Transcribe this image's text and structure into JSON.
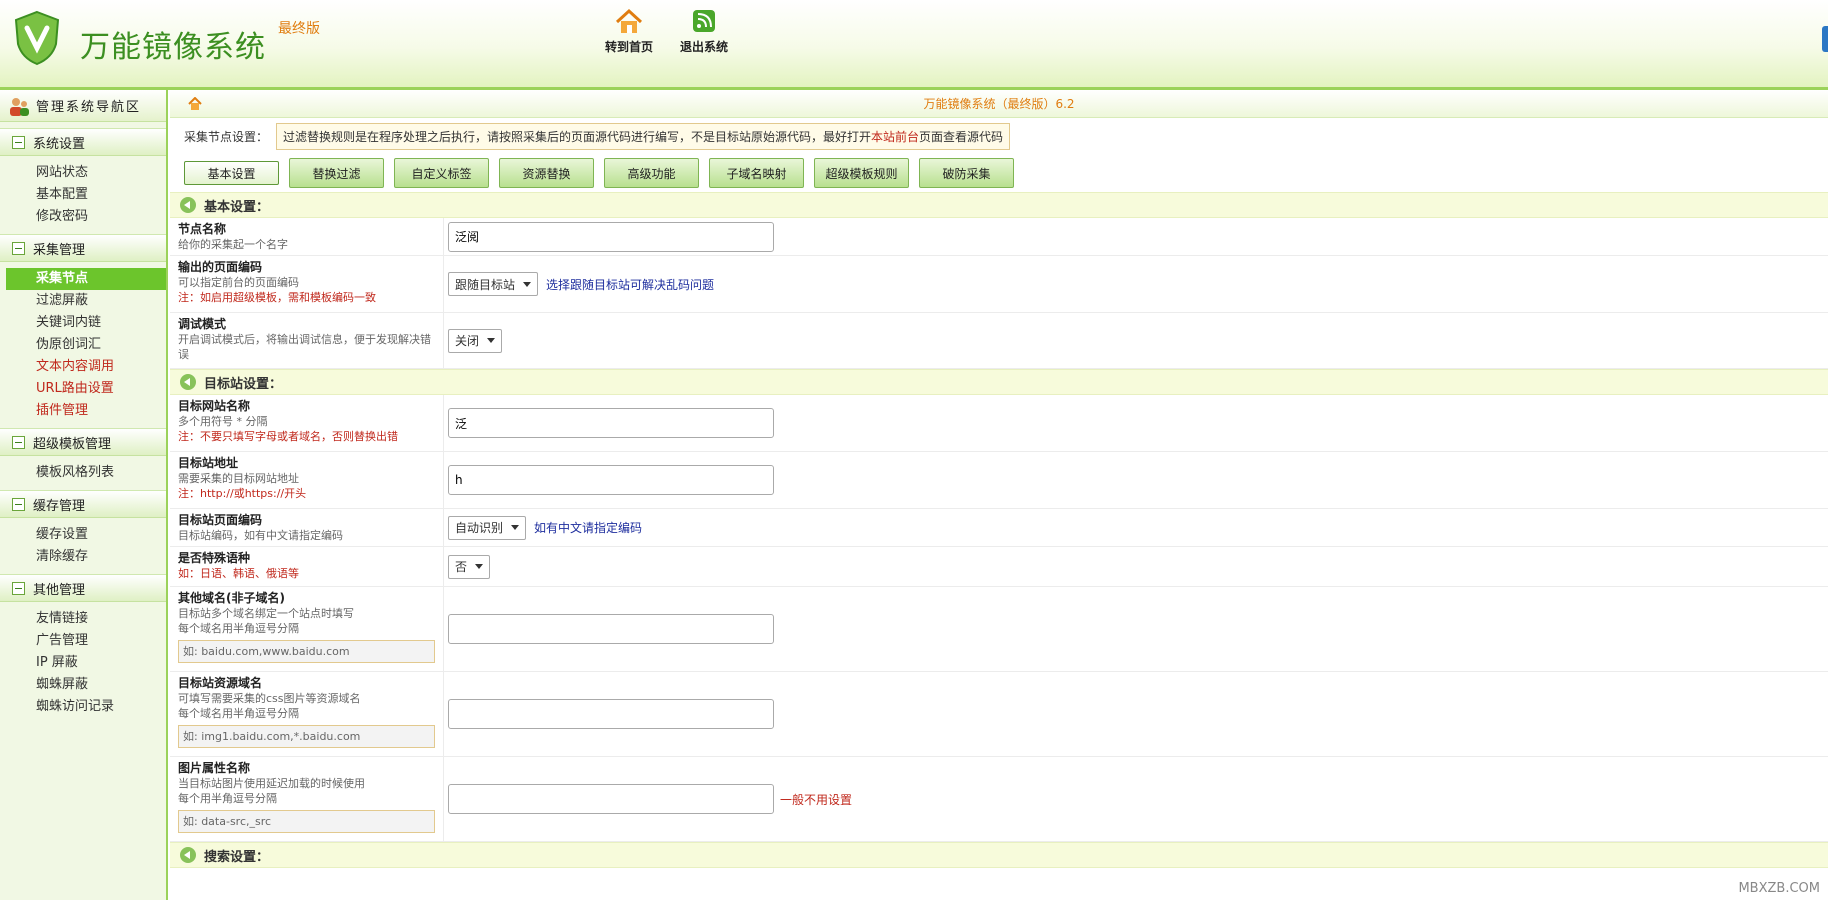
{
  "header": {
    "title": "万能镜像系统",
    "subtitle": "最终版",
    "nav": [
      {
        "label": "转到首页",
        "icon": "home-icon"
      },
      {
        "label": "退出系统",
        "icon": "exit-icon"
      }
    ]
  },
  "sidebar": {
    "title": "管理系统导航区",
    "groups": [
      {
        "label": "系统设置",
        "items": [
          {
            "label": "网站状态"
          },
          {
            "label": "基本配置"
          },
          {
            "label": "修改密码"
          }
        ]
      },
      {
        "label": "采集管理",
        "items": [
          {
            "label": "采集节点"
          },
          {
            "label": "过滤屏蔽"
          },
          {
            "label": "关键词内链"
          },
          {
            "label": "伪原创词汇"
          },
          {
            "label": "文本内容调用"
          },
          {
            "label": "URL路由设置"
          },
          {
            "label": "插件管理"
          }
        ]
      },
      {
        "label": "超级模板管理",
        "items": [
          {
            "label": "模板风格列表"
          }
        ]
      },
      {
        "label": "缓存管理",
        "items": [
          {
            "label": "缓存设置"
          },
          {
            "label": "清除缓存"
          }
        ]
      },
      {
        "label": "其他管理",
        "items": [
          {
            "label": "友情链接"
          },
          {
            "label": "广告管理"
          },
          {
            "label": "IP 屏蔽"
          },
          {
            "label": "蜘蛛屏蔽"
          },
          {
            "label": "蜘蛛访问记录"
          }
        ]
      }
    ]
  },
  "main": {
    "title": "万能镜像系统（最终版）6.2",
    "notice_label": "采集节点设置：",
    "notice_a": "过滤替换规则是在程序处理之后执行，请按照采集后的页面源代码进行编写，不是目标站原始源代码，最好打开",
    "notice_red": "本站前台",
    "notice_b": "页面查看源代码",
    "tabs": [
      "基本设置",
      "替换过滤",
      "自定义标签",
      "资源替换",
      "高级功能",
      "子域名映射",
      "超级模板规则",
      "破防采集"
    ],
    "sections": {
      "basic": "基本设置：",
      "target": "目标站设置：",
      "search": "搜索设置："
    },
    "fields": {
      "node_name": {
        "name": "节点名称",
        "desc": "给你的采集起一个名字",
        "value": "泛阅"
      },
      "output_encoding": {
        "name": "输出的页面编码",
        "desc": "可以指定前台的页面编码",
        "note": "注：如启用超级模板，需和模板编码一致",
        "value": "跟随目标站",
        "link": "选择跟随目标站可解决乱码问题"
      },
      "debug": {
        "name": "调试模式",
        "desc": "开启调试模式后，将输出调试信息，便于发现解决错误",
        "value": "关闭"
      },
      "target_name": {
        "name": "目标网站名称",
        "desc": "多个用符号 * 分隔",
        "note": "注：不要只填写字母或者域名，否则替换出错",
        "value": "泛"
      },
      "target_url": {
        "name": "目标站地址",
        "desc": "需要采集的目标网站地址",
        "note": "注：http://或https://开头",
        "value": "h"
      },
      "target_encoding": {
        "name": "目标站页面编码",
        "desc": "目标站编码，如有中文请指定编码",
        "value": "自动识别",
        "link": "如有中文请指定编码"
      },
      "special_lang": {
        "name": "是否特殊语种",
        "note": "如：日语、韩语、俄语等",
        "value": "否"
      },
      "other_domain": {
        "name": "其他域名(非子域名)",
        "desc": "目标站多个域名绑定一个站点时填写",
        "desc2": "每个域名用半角逗号分隔",
        "hint": "如: baidu.com,www.baidu.com",
        "value": ""
      },
      "resource_domain": {
        "name": "目标站资源域名",
        "desc": "可填写需要采集的css图片等资源域名",
        "desc2": "每个域名用半角逗号分隔",
        "hint": "如: img1.baidu.com,*.baidu.com",
        "value": ""
      },
      "img_attr": {
        "name": "图片属性名称",
        "desc": "当目标站图片使用延迟加载的时候使用",
        "desc2": "每个用半角逗号分隔",
        "hint": "如: data-src,_src",
        "value": "",
        "tip": "一般不用设置"
      }
    }
  },
  "watermark": "MBXZB.COM",
  "colors": {
    "accent": "#6cc52c",
    "brand": "#3c8f21",
    "orange": "#e07d10",
    "red": "#c0281c"
  }
}
